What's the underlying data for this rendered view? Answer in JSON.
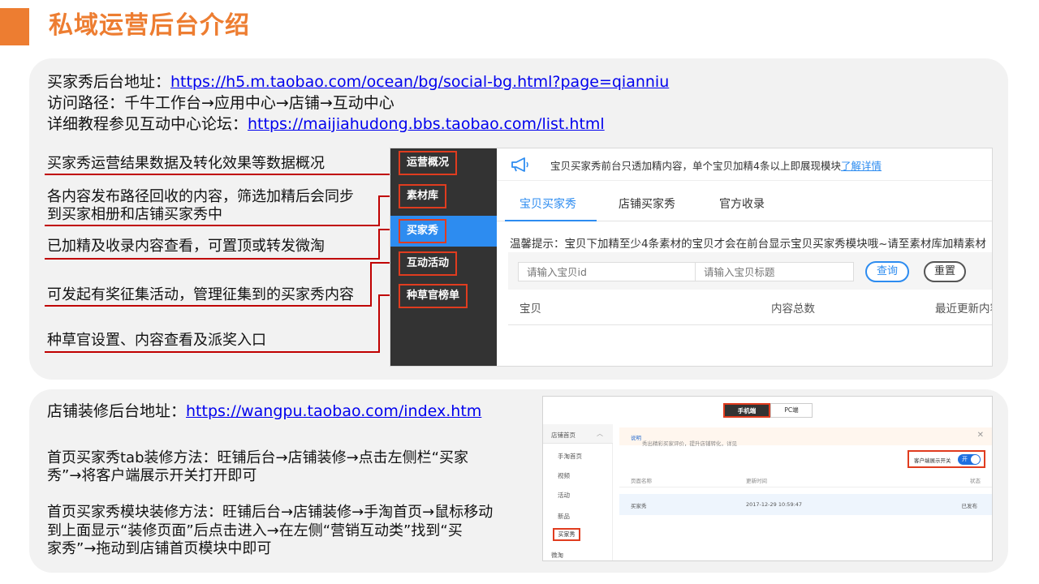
{
  "slide": {
    "title": "私域运营后台介绍",
    "accent_color": "#ED7D31"
  },
  "section1": {
    "line1_label": "买家秀后台地址：",
    "line1_link": "https://h5.m.taobao.com/ocean/bg/social-bg.html?page=qianniu",
    "line2": "访问路径：千牛工作台→应用中心→店铺→互动中心",
    "line3_label": "详细教程参见互动中心论坛：",
    "line3_link": "https://maijiahudong.bbs.taobao.com/list.html",
    "annotations": [
      "买家秀运营结果数据及转化效果等数据概况",
      "各内容发布路径回收的内容，筛选加精后会同步",
      "到买家相册和店铺买家秀中",
      "已加精及收录内容查看，可置顶或转发微淘",
      "可发起有奖征集活动，管理征集到的买家秀内容",
      "种草官设置、内容查看及派奖入口"
    ],
    "screenshot": {
      "sidebar": [
        "运营概况",
        "素材库",
        "买家秀",
        "互动活动",
        "种草官榜单"
      ],
      "active_sidebar": "买家秀",
      "notice_text": "宝贝买家秀前台只透加精内容，单个宝贝加精4条以上即展现模块",
      "notice_link": "了解详情",
      "tabs": [
        "宝贝买家秀",
        "店铺买家秀",
        "官方收录"
      ],
      "active_tab": "宝贝买家秀",
      "tip": "温馨提示：宝贝下加精至少4条素材的宝贝才会在前台显示宝贝买家秀模块哦~请至素材库加精素材",
      "input_id_placeholder": "请输入宝贝id",
      "input_title_placeholder": "请输入宝贝标题",
      "query_button": "查询",
      "reset_button": "重置",
      "columns": [
        "宝贝",
        "内容总数",
        "最近更新内容"
      ],
      "primary_color": "#2D8CF0",
      "sidebar_color": "#333333"
    }
  },
  "section2": {
    "line1_label": "店铺装修后台地址：",
    "line1_link": "https://wangpu.taobao.com/index.htm",
    "para1_line1": "首页买家秀tab装修方法：旺铺后台→店铺装修→点击左侧栏“买家",
    "para1_line2": "秀”→将客户端展示开关打开即可",
    "para2_line1": "首页买家秀模块装修方法：旺铺后台→店铺装修→手淘首页→鼠标移动",
    "para2_line2": "到上面显示“装修页面”后点击进入→在左侧“营销互动类”找到“买",
    "para2_line3": "家秀”→拖动到店铺首页模块中即可",
    "screenshot": {
      "device_tabs": [
        "手机端",
        "PC端"
      ],
      "active_device": "手机端",
      "side_header": "店铺首页",
      "side_items": [
        "手淘首页",
        "视频",
        "活动",
        "新品",
        "买家秀",
        "微淘"
      ],
      "highlighted_item": "买家秀",
      "notice": "秀出精彩买家评价，提升店铺转化，详见",
      "notice_link": "说明",
      "toggle_label": "客户端展示开关",
      "toggle_state": "开",
      "columns": [
        "页面名称",
        "更新时间",
        "状态"
      ],
      "row": {
        "name": "买家秀",
        "time": "2017-12-29 10:59:47",
        "status": "已发布"
      }
    }
  }
}
